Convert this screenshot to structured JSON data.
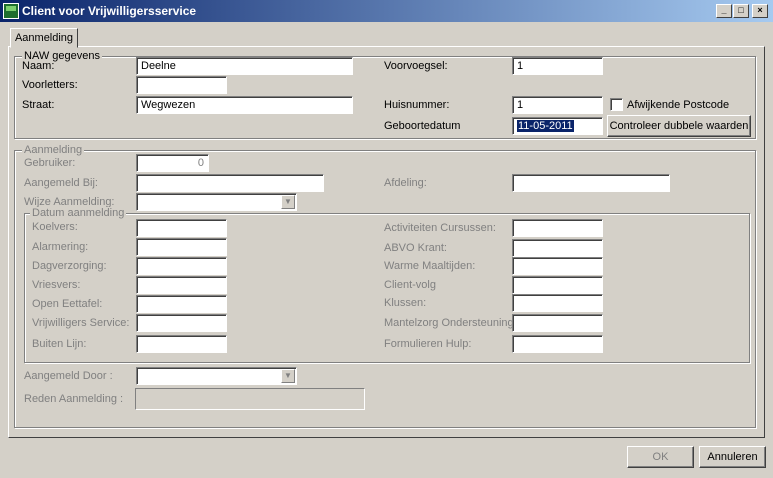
{
  "window": {
    "title": "Client voor Vrijwilligersservice",
    "controls": {
      "minimize": "_",
      "maximize": "□",
      "close": "×"
    }
  },
  "tab": {
    "label": "Aanmelding"
  },
  "naw": {
    "legend": "NAW gegevens",
    "naam_label": "Naam:",
    "naam_value": "Deelne",
    "voorletters_label": "Voorletters:",
    "voorletters_value": "",
    "straat_label": "Straat:",
    "straat_value": "Wegwezen",
    "voorvoegsel_label": "Voorvoegsel:",
    "voorvoegsel_value": "1",
    "huisnummer_label": "Huisnummer:",
    "huisnummer_value": "1",
    "afwijkende_label": "Afwijkende Postcode",
    "afwijkende_checked": false,
    "geboortedatum_label": "Geboortedatum",
    "geboortedatum_value": "11-05-2011",
    "controleer_button": "Controleer dubbele waarden"
  },
  "aanmelding": {
    "legend": "Aanmelding",
    "gebruiker_label": "Gebruiker:",
    "gebruiker_value": "0",
    "aangemeld_bij_label": "Aangemeld Bij:",
    "afdeling_label": "Afdeling:",
    "wijze_label": "Wijze Aanmelding:",
    "datum_legend": "Datum aanmelding",
    "left_items": [
      "Koelvers:",
      "Alarmering:",
      "Dagverzorging:",
      "Vriesvers:",
      "Open Eettafel:",
      "Vrijwilligers Service:",
      "Buiten Lijn:"
    ],
    "right_items": [
      "Activiteiten Cursussen:",
      "ABVO Krant:",
      "Warme Maaltijden:",
      "Client-volg",
      "Klussen:",
      "Mantelzorg Ondersteuning:",
      "Formulieren Hulp:"
    ],
    "aangemeld_door_label": "Aangemeld Door :",
    "reden_label": "Reden Aanmelding :"
  },
  "footer": {
    "ok": "OK",
    "annuleren": "Annuleren"
  }
}
